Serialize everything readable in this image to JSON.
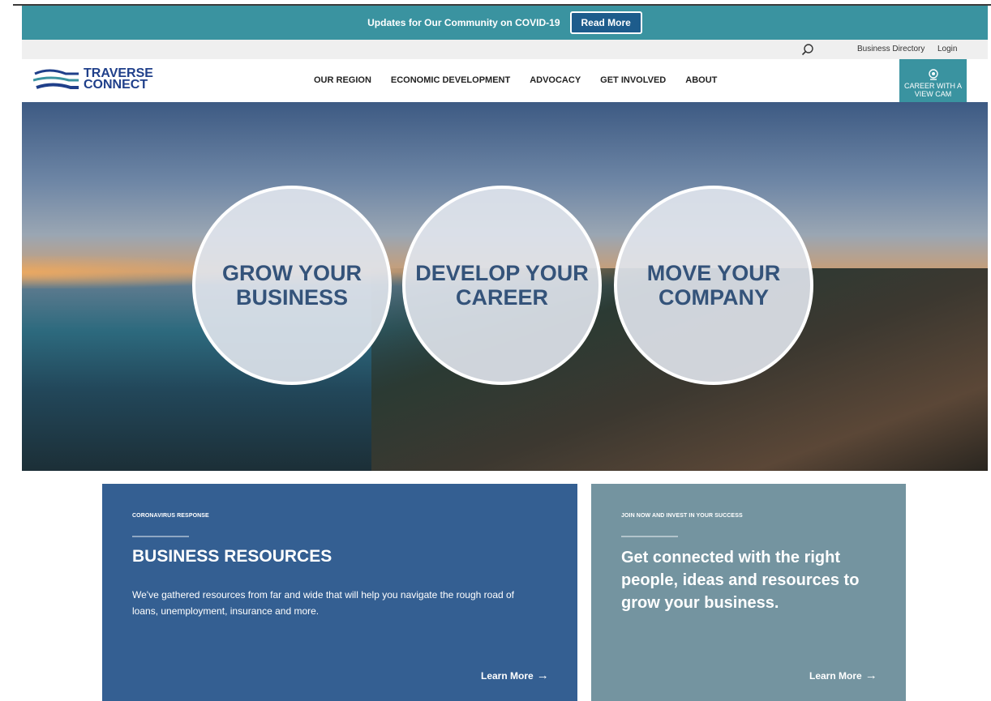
{
  "alert": {
    "text": "Updates for Our Community on COVID-19",
    "button": "Read More"
  },
  "utility": {
    "search_icon": "search-icon",
    "links": [
      "Business Directory",
      "Login"
    ]
  },
  "logo": {
    "line1": "TRAVERSE",
    "line2": "CONNECT"
  },
  "nav": {
    "items": [
      "OUR REGION",
      "ECONOMIC DEVELOPMENT",
      "ADVOCACY",
      "GET INVOLVED",
      "ABOUT"
    ]
  },
  "career": {
    "line1": "CAREER WITH A",
    "line2": "VIEW CAM",
    "icon": "camera-icon"
  },
  "hero": {
    "circles": [
      {
        "line1": "GROW YOUR",
        "line2": "BUSINESS"
      },
      {
        "line1": "DEVELOP YOUR",
        "line2": "CAREER"
      },
      {
        "line1": "MOVE YOUR",
        "line2": "COMPANY"
      }
    ]
  },
  "panels": {
    "left": {
      "eyebrow": "CORONAVIRUS RESPONSE",
      "heading": "BUSINESS RESOURCES",
      "body": "We've gathered resources from far and wide that will help you navigate the rough road of loans, unemployment, insurance and more.",
      "link": "Learn More"
    },
    "right": {
      "eyebrow": "JOIN NOW AND INVEST IN YOUR SUCCESS",
      "heading": "Get connected with the right people, ideas and resources to grow your business.",
      "link": "Learn More"
    }
  },
  "colors": {
    "teal": "#3a93a0",
    "navy_button": "#1d5c8c",
    "brand_blue": "#1f3f8a",
    "panel_blue": "#345f92",
    "panel_slate": "#7494a0",
    "circle_text": "#34537a"
  }
}
